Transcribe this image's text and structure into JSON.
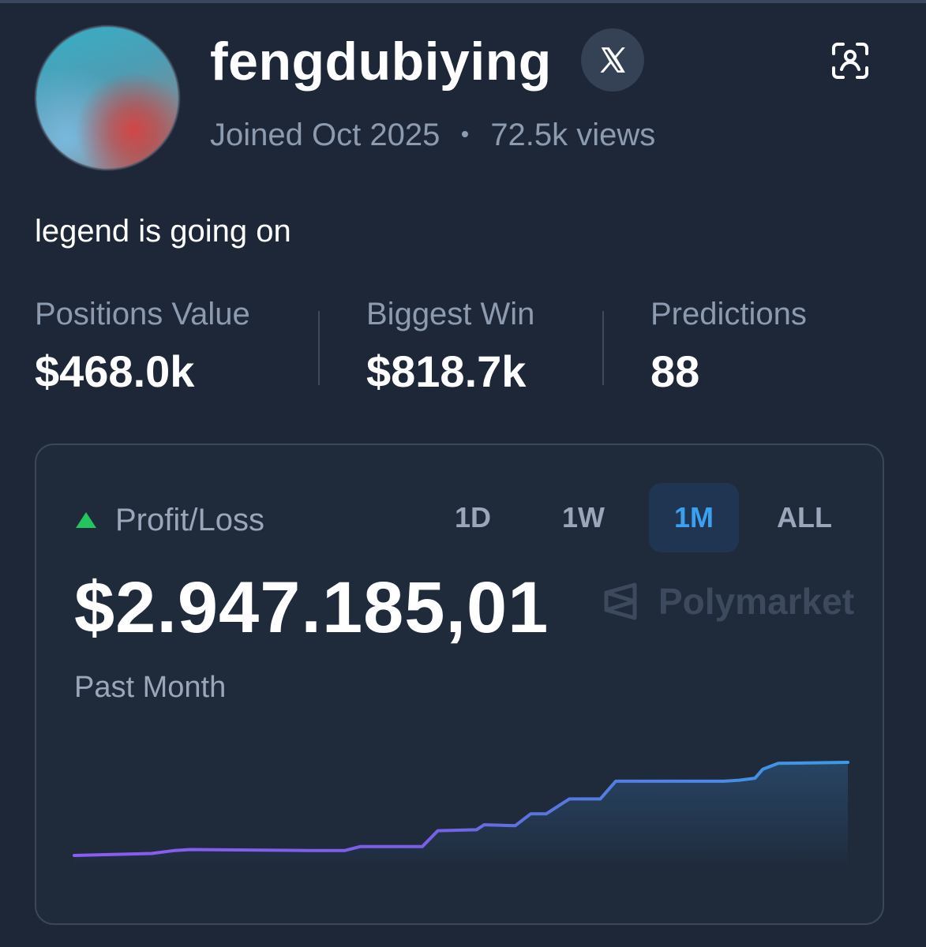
{
  "profile": {
    "username": "fengdubiying",
    "joined": "Joined Oct 2025",
    "views": "72.5k views",
    "bio": "legend is going on",
    "social_icon": "x-logo-icon",
    "action_icon": "scan-profile-icon"
  },
  "stats": [
    {
      "label": "Positions Value",
      "value": "$468.0k"
    },
    {
      "label": "Biggest Win",
      "value": "$818.7k"
    },
    {
      "label": "Predictions",
      "value": "88"
    }
  ],
  "pnl": {
    "title": "Profit/Loss",
    "indicator": "up-triangle-icon",
    "amount": "$2.947.185,01",
    "period_label": "Past Month",
    "brand": "Polymarket",
    "tabs": [
      "1D",
      "1W",
      "1M",
      "ALL"
    ],
    "active_tab": "1M"
  },
  "colors": {
    "background": "#1d2738",
    "up": "#22c55e",
    "active_tab": "#3ba0f0",
    "line_start": "#8b5cf6",
    "line_end": "#3b9be8"
  },
  "chart_data": {
    "type": "area",
    "title": "",
    "xlabel": "",
    "ylabel": "",
    "grid": false,
    "x": [
      0,
      5,
      10,
      13,
      15,
      30,
      35,
      37,
      45,
      47,
      52,
      53,
      57,
      59,
      61,
      64,
      68,
      70,
      75,
      78,
      80,
      82,
      84,
      86,
      88,
      89,
      91,
      100
    ],
    "y": [
      0.0,
      0.01,
      0.02,
      0.05,
      0.06,
      0.05,
      0.05,
      0.09,
      0.09,
      0.25,
      0.26,
      0.31,
      0.3,
      0.42,
      0.42,
      0.57,
      0.57,
      0.75,
      0.75,
      0.75,
      0.75,
      0.75,
      0.75,
      0.76,
      0.78,
      0.87,
      0.93,
      0.94
    ]
  }
}
